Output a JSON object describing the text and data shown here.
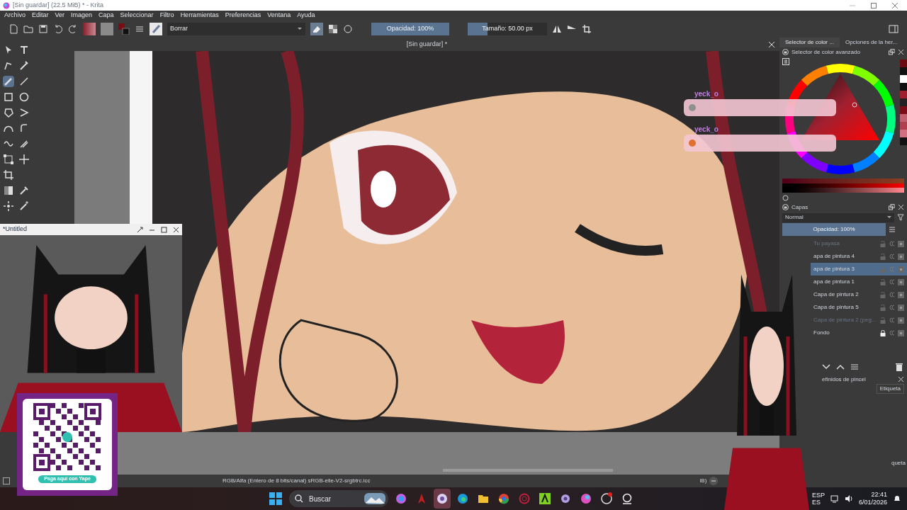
{
  "window": {
    "title": "[Sin guardar]  (22.5 MiB)  * - Krita"
  },
  "menu": [
    "Archivo",
    "Editar",
    "Ver",
    "Imagen",
    "Capa",
    "Seleccionar",
    "Filtro",
    "Herramientas",
    "Preferencias",
    "Ventana",
    "Ayuda"
  ],
  "toolbar": {
    "brush_preset": "Borrar",
    "opacity": {
      "label": "Opacidad: 100%",
      "level": 1
    },
    "size": {
      "label": "Tamaño: 50.00 px",
      "level": 0.25
    }
  },
  "tools": [
    {
      "kind": "select",
      "selected": false
    },
    {
      "kind": "text",
      "selected": false
    },
    {
      "kind": "shape",
      "selected": false
    },
    {
      "kind": "pen",
      "selected": false
    },
    {
      "kind": "brush",
      "selected": true
    },
    {
      "kind": "line",
      "selected": false
    },
    {
      "kind": "rectangle",
      "selected": false
    },
    {
      "kind": "ellipse",
      "selected": false
    },
    {
      "kind": "polygon",
      "selected": false
    },
    {
      "kind": "polyline",
      "selected": false
    },
    {
      "kind": "bezier",
      "selected": false
    },
    {
      "kind": "freehand",
      "selected": false
    },
    {
      "kind": "curve",
      "selected": false
    },
    {
      "kind": "multibrush",
      "selected": false
    },
    {
      "kind": "transform",
      "selected": false
    },
    {
      "kind": "move",
      "selected": false
    },
    {
      "kind": "crop",
      "selected": false
    },
    {
      "kind": "gradient",
      "selected": false
    },
    {
      "kind": "picker",
      "selected": false
    },
    {
      "kind": "patch",
      "selected": false
    },
    {
      "kind": "wand",
      "selected": false
    }
  ],
  "document_tab": {
    "title": "[Sin guardar] *"
  },
  "docker_tabs": [
    {
      "label": "Selector de color ...",
      "selected": true
    },
    {
      "label": "Opciones de la her...",
      "selected": false
    }
  ],
  "color_selector": {
    "title": "Selector de color avanzado"
  },
  "layers": {
    "title": "Capas",
    "blend_mode": "Normal",
    "opacity": {
      "label": "Opacidad:  100%",
      "level": 1
    },
    "items": [
      {
        "name": "Tu payasa",
        "visible": false,
        "selected": false,
        "locked": false
      },
      {
        "name": "apa de pintura 4",
        "visible": true,
        "selected": false,
        "locked": false
      },
      {
        "name": "apa de pintura 3",
        "visible": true,
        "selected": true,
        "locked": false
      },
      {
        "name": "apa de pintura 1",
        "visible": true,
        "selected": false,
        "locked": false
      },
      {
        "name": "Capa de pintura 2",
        "visible": true,
        "selected": false,
        "locked": false
      },
      {
        "name": "Capa de pintura 5",
        "visible": true,
        "selected": false,
        "locked": false
      },
      {
        "name": "Capa de pintura 2 (peg...",
        "visible": false,
        "selected": false,
        "locked": false
      },
      {
        "name": "Fondo",
        "visible": true,
        "selected": false,
        "locked": true
      }
    ]
  },
  "brush_presets": {
    "title": "efinidos de pincel",
    "tag_button": "Etiqueta",
    "footer": "queta"
  },
  "status_bar": {
    "color_info": "RGB/Alfa (Entero de 8 bits/canal)  sRGB-elle-V2-srgbtrc.icc",
    "size_fragment": "iB)"
  },
  "overlay_window": {
    "title": "*Untitled"
  },
  "chat": [
    {
      "user": "yeck_o"
    },
    {
      "user": "yeck_o"
    }
  ],
  "qr_card": {
    "button": "Paga aquí con Yape"
  },
  "taskbar": {
    "search_placeholder": "Buscar",
    "apps": [
      {
        "kind": "copilot",
        "selected": false
      },
      {
        "kind": "dragon",
        "selected": false
      },
      {
        "kind": "krita",
        "selected": true
      },
      {
        "kind": "edge",
        "selected": false
      },
      {
        "kind": "folder",
        "selected": false
      },
      {
        "kind": "chrome",
        "selected": false
      },
      {
        "kind": "ring",
        "selected": false
      },
      {
        "kind": "letter-tile",
        "selected": false
      },
      {
        "kind": "gear",
        "selected": false
      },
      {
        "kind": "ball",
        "selected": false
      },
      {
        "kind": "obs",
        "selected": false
      },
      {
        "kind": "camera",
        "selected": false
      }
    ],
    "language": "ESP",
    "region": "ES",
    "time": "22:41",
    "date": "6/01/2026"
  }
}
